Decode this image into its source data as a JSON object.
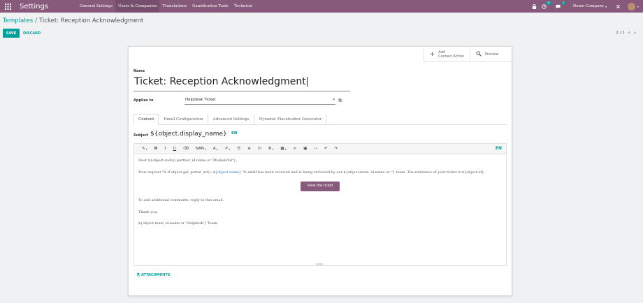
{
  "navbar": {
    "app_title": "Settings",
    "menu": [
      {
        "label": "General Settings",
        "active": false
      },
      {
        "label": "Users & Companies",
        "active": true
      },
      {
        "label": "Translations",
        "active": false
      },
      {
        "label": "Gamification Tools",
        "active": false
      },
      {
        "label": "Technical",
        "active": false
      }
    ],
    "activity_count": "29",
    "message_count": "3",
    "company": "Demo Company",
    "accent": "#875a7b"
  },
  "breadcrumb": {
    "parent": "Templates",
    "separator": "/",
    "current": "Ticket: Reception Acknowledgment"
  },
  "actions": {
    "save": "SAVE",
    "discard": "DISCARD"
  },
  "pager": {
    "value": "2 / 2"
  },
  "button_box": {
    "context_action_line1": "Add",
    "context_action_line2": "Context Action",
    "preview": "Preview"
  },
  "form": {
    "name_label": "Name",
    "name_value": "Ticket: Reception Acknowledgment",
    "applies_label": "Applies to",
    "applies_value": "Helpdesk Ticket",
    "tabs": [
      "Content",
      "Email Configuration",
      "Advanced Settings",
      "Dynamic Placeholder Generator"
    ],
    "subject_label": "Subject",
    "subject_value": "${object.display_name}",
    "subject_lang": "EN"
  },
  "editor": {
    "toolbar": {
      "font_size": "NAN",
      "lang": "EN"
    },
    "body": {
      "greeting": "Dear ${object.sudo().partner_id.name or 'Madam/Sir'},",
      "p1_before": "Your request '% if object.get_portal_url(): ",
      "p1_highlight": "${object.name}",
      "p1_after": " '% endif has been received and is being reviewed by our ${object.team_id.name or ''} team. The reference of your ticket is ${object.id}.",
      "button": "View the ticket",
      "p2": "To add additional comments, reply to this email.",
      "p3": "Thank you,",
      "p4": "${object.team_id.name or 'Helpdesk'} Team."
    }
  },
  "attachments_label": "ATTACHMENTS",
  "colors": {
    "primary": "#00a09d",
    "brand": "#875a7b"
  }
}
